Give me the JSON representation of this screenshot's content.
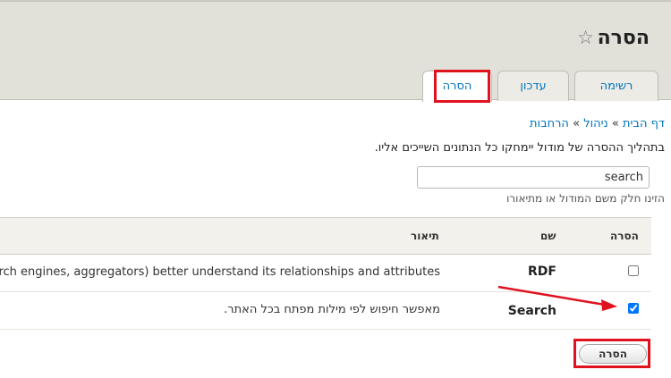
{
  "page": {
    "title": "הסרה"
  },
  "tabs": [
    {
      "label": "רשימה"
    },
    {
      "label": "עדכון"
    },
    {
      "label": "הסרה"
    }
  ],
  "breadcrumb": [
    {
      "label": "דף הבית"
    },
    {
      "label": "ניהול"
    },
    {
      "label": "הרחבות"
    }
  ],
  "breadcrumb_separator": "»",
  "description": "בתהליך ההסרה של מודול יימחקו כל הנתונים השייכים אליו.",
  "search": {
    "value": "search",
    "help": "הזינו חלק משם המודול או מתיאורו"
  },
  "table": {
    "headers": {
      "remove": "הסרה",
      "name": "שם",
      "description": "תיאור"
    },
    "rows": [
      {
        "name": "RDF",
        "description": "rch engines, aggregators) better understand its relationships and attributes",
        "checked": false
      },
      {
        "name": "Search",
        "description": "מאפשר חיפוש לפי מילות מפתח בכל האתר.",
        "checked": true
      }
    ]
  },
  "submit": {
    "label": "הסרה"
  },
  "colors": {
    "link": "#0074bd",
    "highlight": "#e0121e",
    "header_bg": "#e1e0d9"
  },
  "icons": {
    "favorite": "star-outline-icon"
  }
}
